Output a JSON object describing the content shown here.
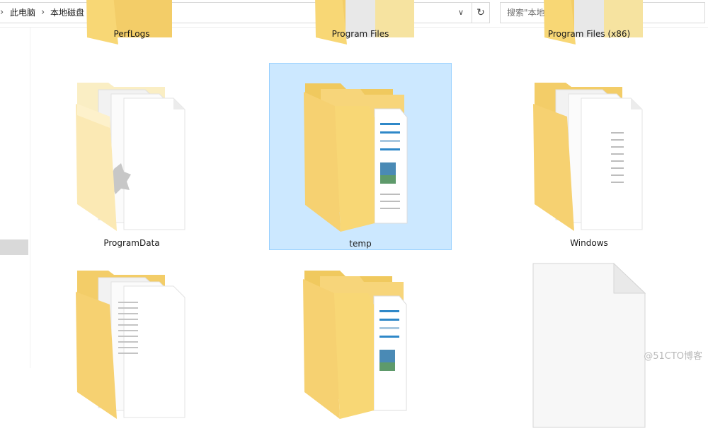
{
  "address_bar": {
    "breadcrumbs": [
      "此电脑",
      "本地磁盘 (C:)"
    ],
    "dropdown_icon": "chevron-down-icon",
    "refresh_icon": "refresh-icon"
  },
  "search": {
    "placeholder": "搜索\"本地磁盘 (C:)\""
  },
  "items": [
    {
      "name": "PerfLogs",
      "type": "folder",
      "selected": false
    },
    {
      "name": "Program Files",
      "type": "folder",
      "selected": false
    },
    {
      "name": "Program Files (x86)",
      "type": "folder",
      "selected": false
    },
    {
      "name": "ProgramData",
      "type": "folder",
      "selected": false
    },
    {
      "name": "temp",
      "type": "folder",
      "selected": true
    },
    {
      "name": "Windows",
      "type": "folder",
      "selected": false
    },
    {
      "name": "",
      "type": "folder",
      "selected": false
    },
    {
      "name": "",
      "type": "folder",
      "selected": false
    },
    {
      "name": "",
      "type": "file",
      "selected": false
    }
  ],
  "watermark": "@51CTO博客",
  "colors": {
    "selection_fill": "#cce8ff",
    "selection_border": "#99d1ff",
    "folder_yellow": "#f8d775"
  }
}
